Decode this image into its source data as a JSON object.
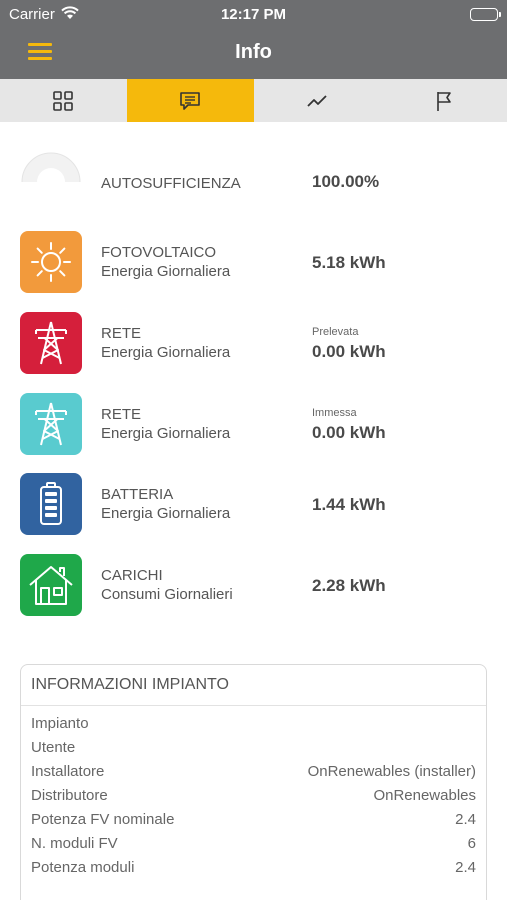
{
  "status_bar": {
    "carrier": "Carrier",
    "time": "12:17 PM"
  },
  "header": {
    "title": "Info",
    "menu_icon": "hamburger-menu-icon"
  },
  "tabs": [
    {
      "icon": "grid-icon",
      "active": false
    },
    {
      "icon": "message-icon",
      "active": true
    },
    {
      "icon": "chart-line-icon",
      "active": false
    },
    {
      "icon": "flag-icon",
      "active": false
    }
  ],
  "rows": {
    "autosufficienza": {
      "label": "AUTOSUFFICIENZA",
      "value": "100.00%",
      "gauge_fraction": 1.0
    },
    "fotovoltaico": {
      "line1": "FOTOVOLTAICO",
      "line2": "Energia Giornaliera",
      "value": "5.18 kWh",
      "icon": "sun-icon",
      "color": "#f29a3c"
    },
    "rete_prelevata": {
      "line1": "RETE",
      "line2": "Energia Giornaliera",
      "sub": "Prelevata",
      "value": "0.00 kWh",
      "icon": "power-tower-icon",
      "color": "#d51f3b"
    },
    "rete_immessa": {
      "line1": "RETE",
      "line2": "Energia Giornaliera",
      "sub": "Immessa",
      "value": "0.00 kWh",
      "icon": "power-tower-icon",
      "color": "#59cbcf"
    },
    "batteria": {
      "line1": "BATTERIA",
      "line2": "Energia Giornaliera",
      "value": "1.44 kWh",
      "icon": "battery-icon",
      "color": "#3163a0"
    },
    "carichi": {
      "line1": "CARICHI",
      "line2": "Consumi Giornalieri",
      "value": "2.28 kWh",
      "icon": "house-icon",
      "color": "#1fa84a"
    }
  },
  "info_card": {
    "title": "INFORMAZIONI IMPIANTO",
    "rows": [
      {
        "key": "Impianto",
        "value": ""
      },
      {
        "key": "Utente",
        "value": ""
      },
      {
        "key": "Installatore",
        "value": "OnRenewables (installer)"
      },
      {
        "key": "Distributore",
        "value": "OnRenewables"
      },
      {
        "key": "Potenza FV nominale",
        "value": "2.4"
      },
      {
        "key": "N. moduli FV",
        "value": "6"
      },
      {
        "key": "Potenza moduli",
        "value": "2.4"
      }
    ]
  }
}
